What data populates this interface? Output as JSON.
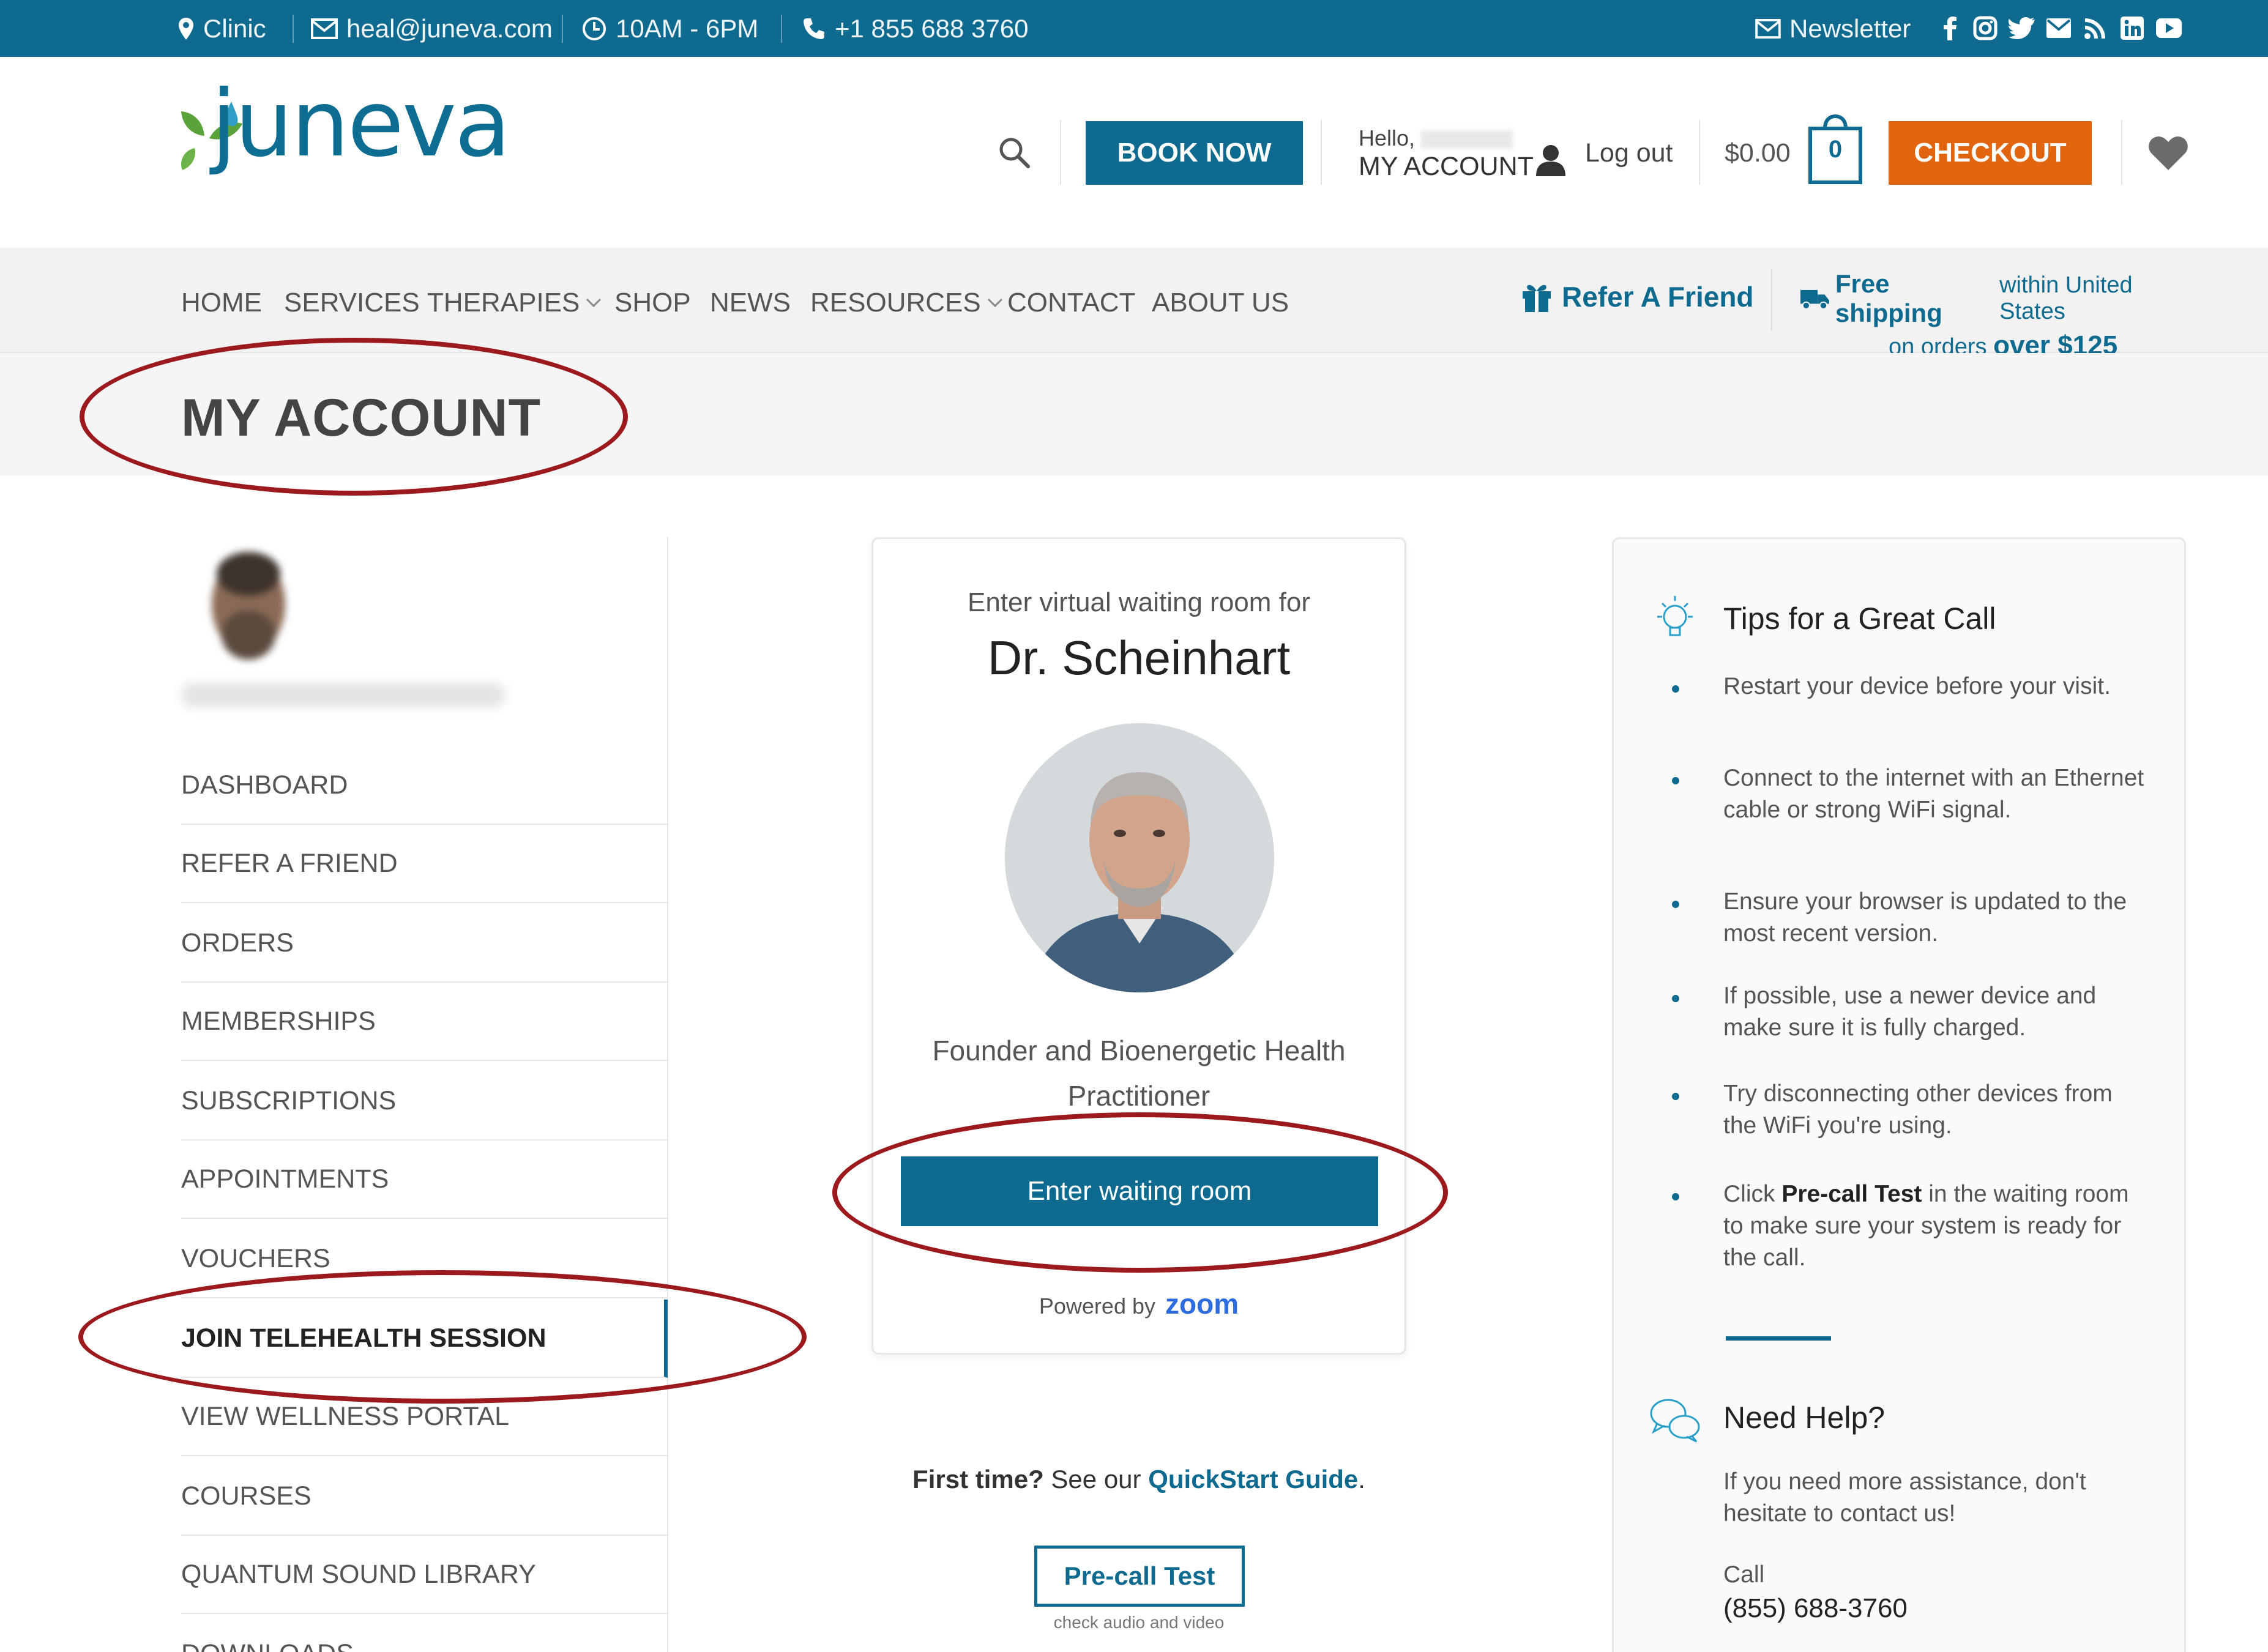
{
  "topbar": {
    "clinic": "Clinic",
    "email": "heal@juneva.com",
    "hours": "10AM - 6PM",
    "phone": "+1 855 688 3760",
    "newsletter": "Newsletter",
    "social_icons": [
      "facebook-icon",
      "instagram-icon",
      "twitter-icon",
      "email-icon",
      "rss-icon",
      "linkedin-icon",
      "youtube-icon"
    ]
  },
  "header": {
    "logo": "juneva",
    "book_now": "BOOK NOW",
    "hello": "Hello,",
    "my_account": "MY ACCOUNT",
    "logout": "Log out",
    "cart_total": "$0.00",
    "cart_count": "0",
    "checkout": "CHECKOUT"
  },
  "nav": {
    "items": [
      "HOME",
      "SERVICES",
      "THERAPIES",
      "SHOP",
      "NEWS",
      "RESOURCES",
      "CONTACT",
      "ABOUT US"
    ],
    "refer": "Refer A Friend",
    "shipping_line1_bold": "Free shipping",
    "shipping_line1_rest": "within United States",
    "shipping_line2_pre": "on orders",
    "shipping_line2_bold": "over $125"
  },
  "page": {
    "title": "MY ACCOUNT"
  },
  "sidebar": {
    "items": [
      "DASHBOARD",
      "REFER A FRIEND",
      "ORDERS",
      "MEMBERSHIPS",
      "SUBSCRIPTIONS",
      "APPOINTMENTS",
      "VOUCHERS",
      "JOIN TELEHEALTH SESSION",
      "VIEW WELLNESS PORTAL",
      "COURSES",
      "QUANTUM SOUND LIBRARY",
      "DOWNLOADS"
    ],
    "active": "JOIN TELEHEALTH SESSION"
  },
  "card": {
    "intro": "Enter virtual waiting room for",
    "doctor": "Dr. Scheinhart",
    "role_line1": "Founder and Bioenergetic Health",
    "role_line2": "Practitioner",
    "button": "Enter waiting room",
    "powered_by": "Powered by",
    "zoom": "zoom"
  },
  "below_card": {
    "first_time": "First time?",
    "see_our": "See our",
    "guide": "QuickStart Guide",
    "period": ".",
    "precall": "Pre-call Test",
    "precall_sub": "check audio and video"
  },
  "tips": {
    "title": "Tips for a Great Call",
    "items": [
      "Restart your device before your visit.",
      "Connect to the internet with an Ethernet cable or strong WiFi signal.",
      "Ensure your browser is updated to the most recent version.",
      "If possible, use a newer device and make sure it is fully charged.",
      "Try disconnecting other devices from the WiFi you're using."
    ],
    "last_pre": "Click",
    "last_bold": "Pre-call Test",
    "last_post": "in the waiting room to make sure your system is ready for the call.",
    "help_title": "Need Help?",
    "help_text": "If you need more assistance, don't hesitate to contact us!",
    "call_label": "Call",
    "call_number": "(855) 688-3760"
  },
  "colors": {
    "brand_blue": "#0f6a8f",
    "checkout_orange": "#e0650e",
    "annotation_red": "#9c1a1d",
    "leaf_green": "#5aa33a"
  }
}
